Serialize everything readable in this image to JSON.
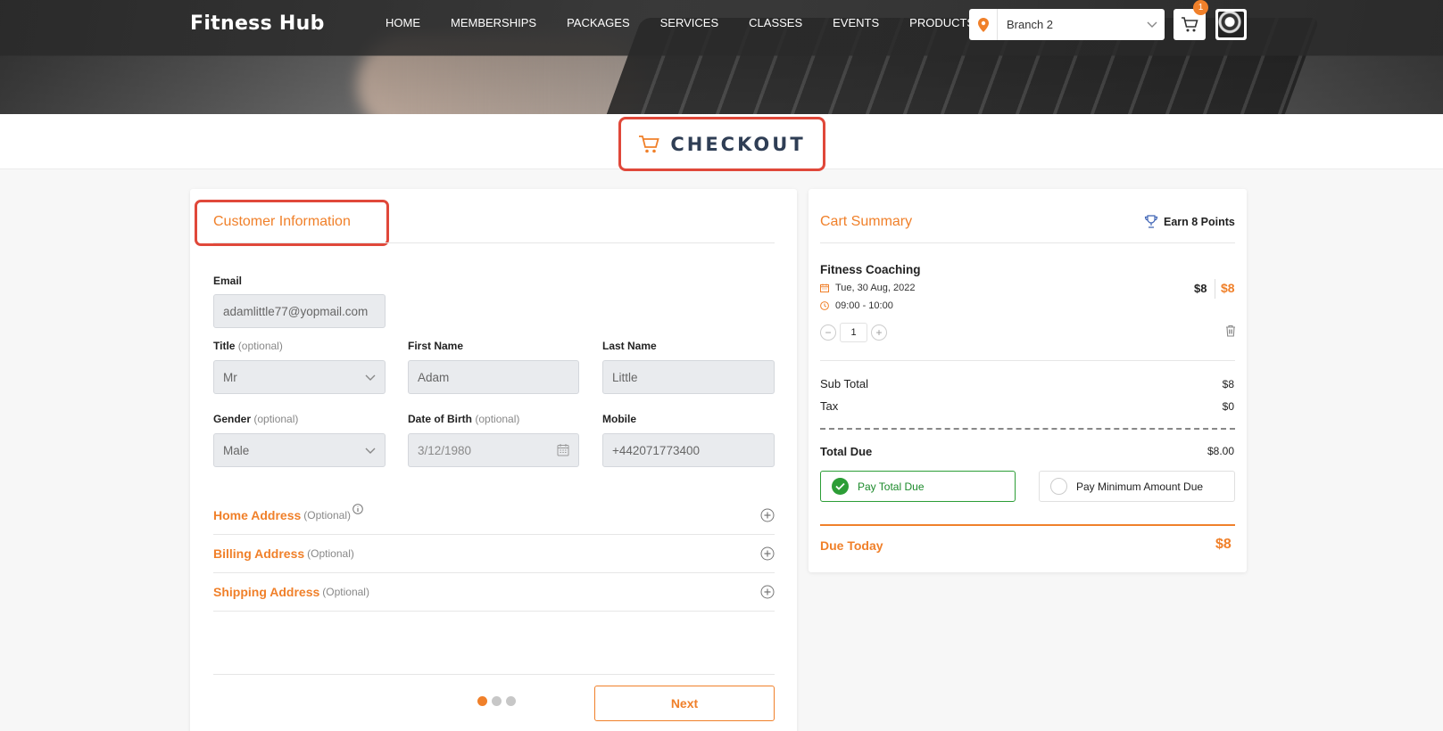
{
  "header": {
    "brand": "Fitness Hub",
    "nav": [
      "HOME",
      "MEMBERSHIPS",
      "PACKAGES",
      "SERVICES",
      "CLASSES",
      "EVENTS",
      "PRODUCTS"
    ],
    "branch_select": "Branch 2",
    "cart_count": "1"
  },
  "page": {
    "title": "CHECKOUT"
  },
  "customer": {
    "section_title": "Customer Information",
    "email_label": "Email",
    "email_value": "adamlittle77@yopmail.com",
    "title_label": "Title",
    "title_value": "Mr",
    "first_name_label": "First Name",
    "first_name_value": "Adam",
    "last_name_label": "Last Name",
    "last_name_value": "Little",
    "gender_label": "Gender",
    "gender_value": "Male",
    "dob_label": "Date of Birth",
    "dob_value": "3/12/1980",
    "mobile_label": "Mobile",
    "mobile_value": "+442071773400",
    "optional_lower": "(optional)",
    "optional_cap": "(Optional)",
    "home_address": "Home Address",
    "billing_address": "Billing Address",
    "shipping_address": "Shipping Address",
    "next_label": "Next",
    "step_current": 1,
    "step_total": 3
  },
  "cart": {
    "title": "Cart Summary",
    "points": "Earn 8 Points",
    "item": {
      "name": "Fitness Coaching",
      "date": "Tue, 30 Aug, 2022",
      "time": "09:00 - 10:00",
      "price": "$8",
      "total": "$8",
      "qty": "1",
      "minus": "−",
      "plus": "+"
    },
    "sub_total_label": "Sub Total",
    "sub_total": "$8",
    "tax_label": "Tax",
    "tax": "$0",
    "total_due_label": "Total Due",
    "total_due": "$8.00",
    "pay_total": "Pay Total Due",
    "pay_min": "Pay Minimum Amount Due",
    "due_today_label": "Due Today",
    "due_today": "$8"
  },
  "colors": {
    "accent": "#f0802a",
    "highlight": "#e0483a",
    "success": "#2c9d36",
    "heading": "#2f3e55"
  }
}
